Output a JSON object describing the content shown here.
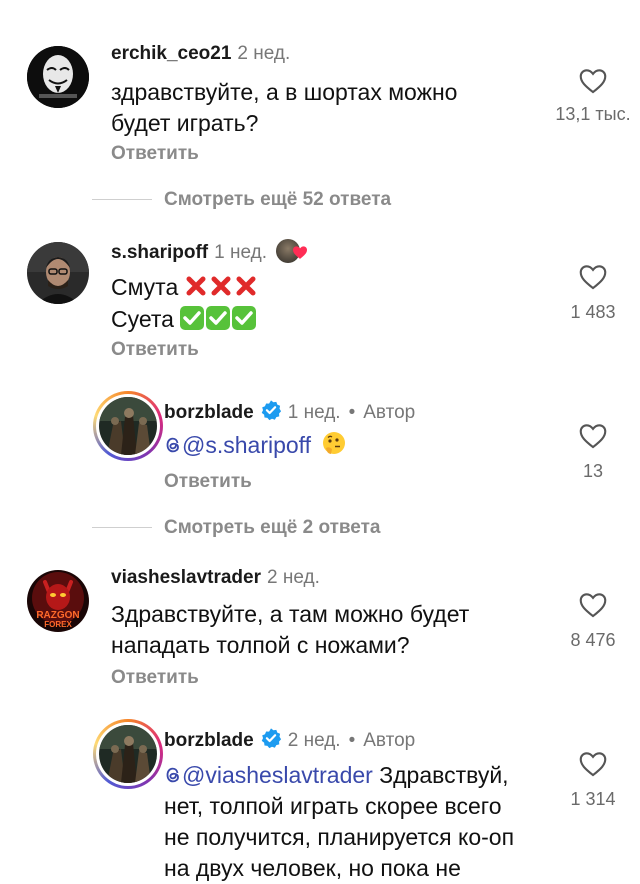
{
  "comments": [
    {
      "username": "erchik_ceo21",
      "time": "2 нед.",
      "lines": [
        "здравствуйте, а в шортах можно",
        "будет играть?"
      ],
      "likes": "13,1 тыс.",
      "reply_label": "Ответить"
    },
    {
      "username": "s.sharipoff",
      "time": "1 нед.",
      "line1_text": "Смута",
      "line2_text": "Суета",
      "likes": "1 483",
      "reply_label": "Ответить"
    },
    {
      "username": "borzblade",
      "time": "1 нед.",
      "author_label": "Автор",
      "mention": "@s.sharipoff",
      "likes": "13",
      "reply_label": "Ответить"
    },
    {
      "username": "viasheslavtrader",
      "time": "2 нед.",
      "lines": [
        "Здравствуйте, а там можно будет",
        "нападать толпой с ножами?"
      ],
      "likes": "8 476",
      "reply_label": "Ответить",
      "avatar_text": [
        "RAZGON",
        "FOREX"
      ]
    },
    {
      "username": "borzblade",
      "time": "2 нед.",
      "author_label": "Автор",
      "mention": "@viasheslavtrader",
      "line1_rest": " Здравствуй,",
      "lines": [
        "нет, толпой играть скорее всего",
        "не получится, планируется ко-оп",
        "на двух человек, но пока не"
      ],
      "likes": "1 314"
    }
  ],
  "view_more": [
    "Смотреть ещё 52 ответа",
    "Смотреть ещё 2 ответа"
  ],
  "colors": {
    "mention": "#3949ab",
    "verified": "#1d9bf0",
    "muted": "#8a8a8a"
  },
  "icons": [
    "heart-icon",
    "verified-badge-icon",
    "cross-mark-emoji",
    "check-mark-emoji",
    "thinking-face-emoji"
  ]
}
